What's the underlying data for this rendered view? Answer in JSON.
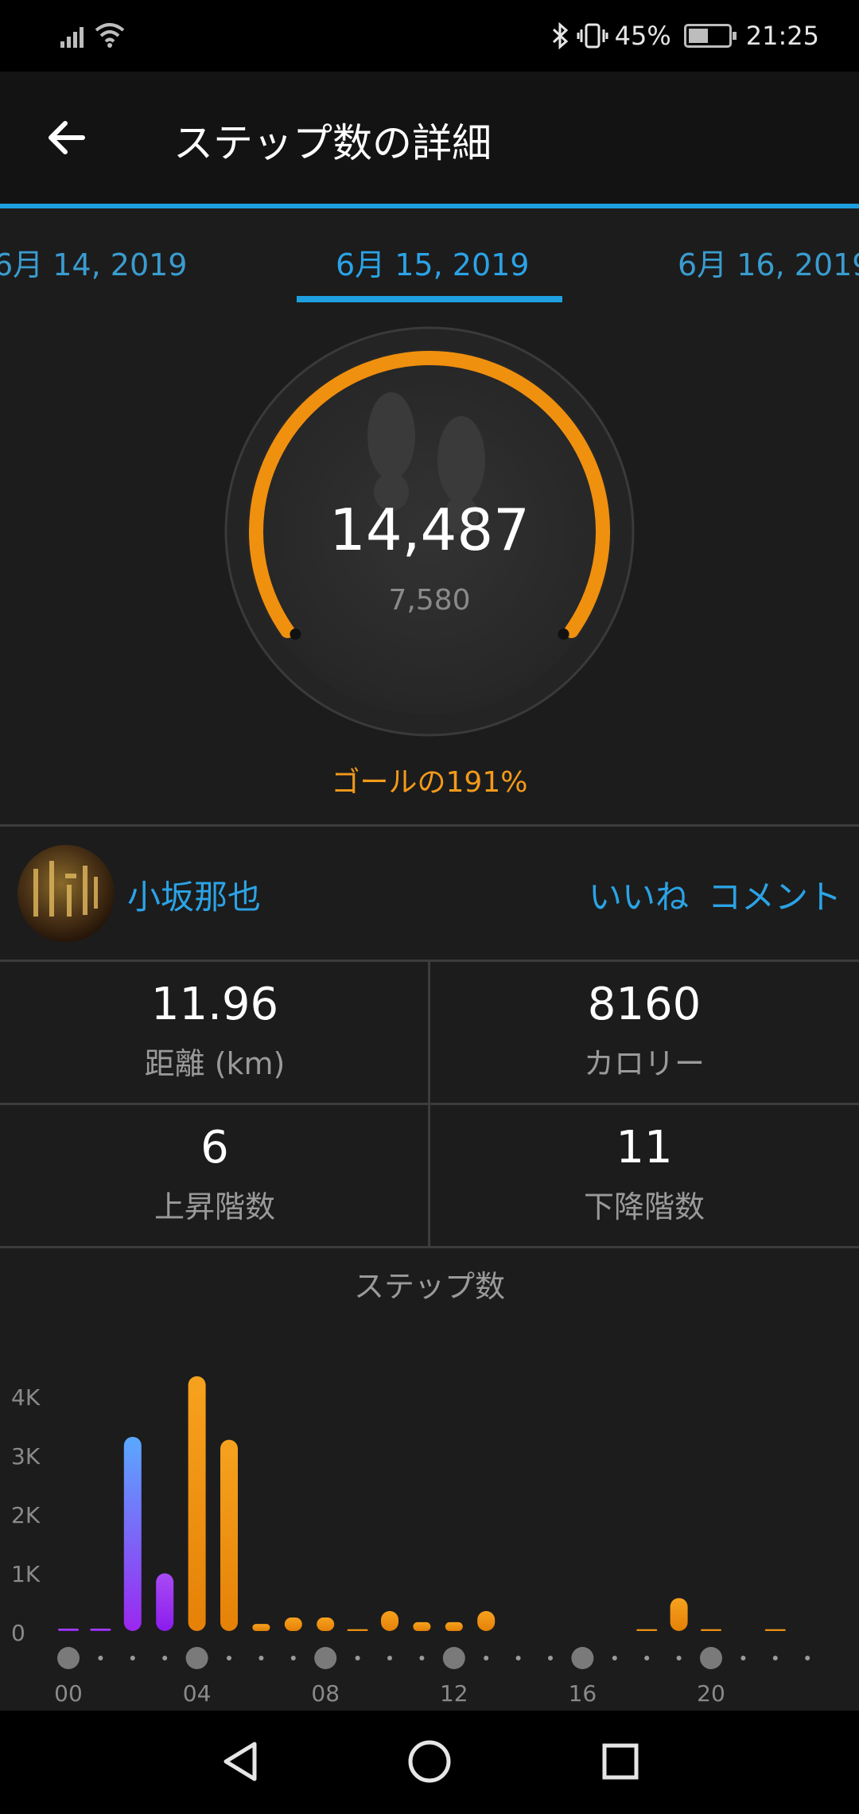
{
  "status_bar": {
    "battery": "45%",
    "time": "21:25"
  },
  "app_bar": {
    "title": "ステップ数の詳細"
  },
  "date_tabs": {
    "prev": "6月 14, 2019",
    "current": "6月 15, 2019",
    "next": "6月 16, 2019"
  },
  "summary": {
    "steps": "14,487",
    "goal": "7,580",
    "goal_percent_text": "ゴールの191%",
    "goal_fraction": 1.91
  },
  "social": {
    "user_name": "小坂那也",
    "like_label": "いいね",
    "comment_label": "コメント"
  },
  "stats": [
    {
      "value": "11.96",
      "label": "距離 (km)"
    },
    {
      "value": "8160",
      "label": "カロリー"
    },
    {
      "value": "6",
      "label": "上昇階数"
    },
    {
      "value": "11",
      "label": "下降階数"
    }
  ],
  "colors": {
    "accent_blue": "#1d9fe0",
    "goal_orange": "#f39a1b",
    "sleep_purple": "#9b27f0",
    "sleep_blue": "#5aa9ff"
  },
  "chart_data": {
    "type": "bar",
    "title": "ステップ数",
    "ylabel": "",
    "xlabel": "",
    "ylim": [
      0,
      4300
    ],
    "y_ticks": [
      "0",
      "1K",
      "2K",
      "3K",
      "4K"
    ],
    "y_tick_values": [
      0,
      1000,
      2000,
      3000,
      4000
    ],
    "x_tick_labels": [
      "00",
      "04",
      "08",
      "12",
      "16",
      "20"
    ],
    "x_tick_hours": [
      0,
      4,
      8,
      12,
      16,
      20
    ],
    "categories": [
      "00",
      "01",
      "02",
      "03",
      "04",
      "05",
      "06",
      "07",
      "08",
      "09",
      "10",
      "11",
      "12",
      "13",
      "14",
      "15",
      "16",
      "17",
      "18",
      "19",
      "20",
      "21",
      "22",
      "23"
    ],
    "values": [
      40,
      40,
      3300,
      980,
      4330,
      3250,
      120,
      230,
      230,
      30,
      340,
      150,
      150,
      340,
      0,
      0,
      0,
      0,
      30,
      560,
      30,
      0,
      30,
      0
    ],
    "bar_colors": [
      "purple",
      "purple",
      "purple-blue",
      "purple",
      "orange",
      "orange",
      "orange",
      "orange",
      "orange",
      "orange",
      "orange",
      "orange",
      "orange",
      "orange",
      "orange",
      "orange",
      "orange",
      "orange",
      "orange",
      "orange",
      "orange",
      "orange",
      "orange",
      "orange"
    ]
  }
}
